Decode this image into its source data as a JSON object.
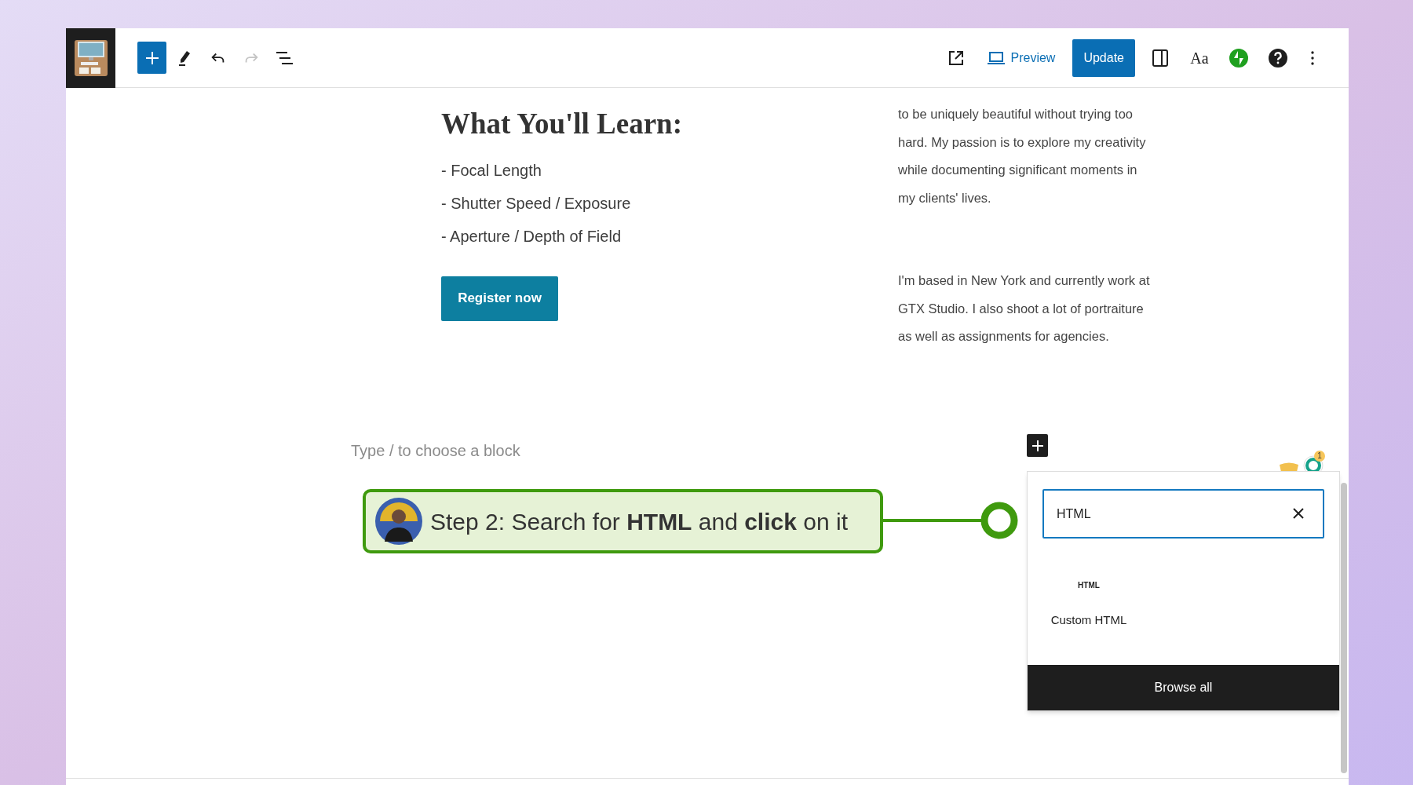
{
  "toolbar": {
    "history": [
      {
        "kind": "undo",
        "disabled": false
      },
      {
        "kind": "redo",
        "disabled": true
      }
    ],
    "preview": "Preview",
    "update": "Update",
    "styles": "Aa"
  },
  "content": {
    "heading": "What You'll Learn:",
    "list": [
      "- Focal Length",
      "- Shutter Speed / Exposure",
      "- Aperture / Depth of Field"
    ],
    "button": "Register now",
    "side_paragraphs": [
      [
        "to be uniquely beautiful without trying too",
        "hard. My passion is to explore my creativity",
        "while documenting significant moments in",
        "my clients' lives."
      ],
      [
        "I'm based in New York and currently work at",
        "GTX Studio. I also shoot a lot of portraiture",
        "as well as assignments for agencies."
      ]
    ],
    "block_placeholder": "Type / to choose a block"
  },
  "callout": {
    "text": "Step 2: Search for **HTML** and **click** on it"
  },
  "notification_badge": "1",
  "inserter": {
    "search_value": "HTML",
    "results": [
      {
        "icon_text": "HTML",
        "label": "Custom HTML"
      }
    ],
    "browse_all": "Browse all"
  }
}
